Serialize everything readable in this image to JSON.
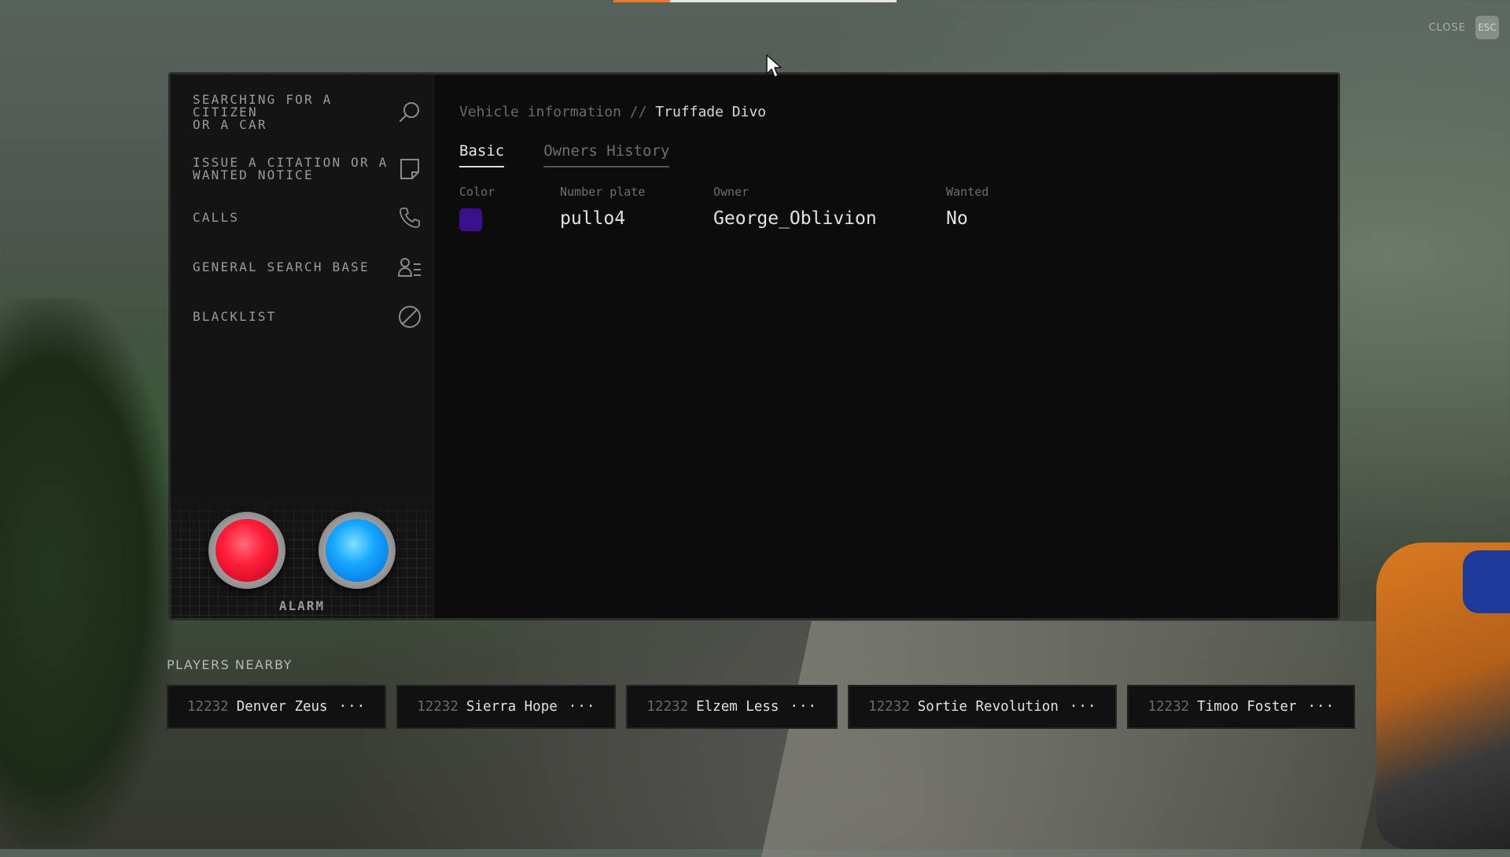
{
  "top_bar": {
    "progress": 0.2,
    "accent_color": "#e87a2a"
  },
  "close": {
    "label": "CLOSE",
    "key": "ESC"
  },
  "sidebar": {
    "items": [
      {
        "label": "SEARCHING FOR A\nCITIZEN\nOR A CAR",
        "icon": "search-icon"
      },
      {
        "label": "ISSUE A CITATION OR A\nWANTED NOTICE",
        "icon": "note-icon"
      },
      {
        "label": "CALLS",
        "icon": "phone-icon"
      },
      {
        "label": "GENERAL SEARCH BASE",
        "icon": "user-list-icon"
      },
      {
        "label": "BLACKLIST",
        "icon": "ban-icon"
      }
    ],
    "alarm": {
      "label": "ALARM",
      "red_color": "#ff1f3a",
      "blue_color": "#17a7ff"
    }
  },
  "main": {
    "breadcrumb": {
      "section": "Vehicle information //",
      "current": "Truffade Divo"
    },
    "tabs": [
      {
        "label": "Basic",
        "active": true
      },
      {
        "label": "Owners History",
        "active": false
      }
    ],
    "fields": {
      "color": {
        "label": "Color",
        "value": "#3a0f8a"
      },
      "plate": {
        "label": "Number plate",
        "value": "pullo4"
      },
      "owner": {
        "label": "Owner",
        "value": "George_Oblivion"
      },
      "wanted": {
        "label": "Wanted",
        "value": "No"
      }
    }
  },
  "players_nearby": {
    "title": "PLAYERS NEARBY",
    "players": [
      {
        "id": "12232",
        "name": "Denver Zeus",
        "more": "···"
      },
      {
        "id": "12232",
        "name": "Sierra Hope",
        "more": "···"
      },
      {
        "id": "12232",
        "name": "Elzem Less",
        "more": "···"
      },
      {
        "id": "12232",
        "name": "Sortie Revolution",
        "more": "···"
      },
      {
        "id": "12232",
        "name": "Timoo Foster",
        "more": "···"
      }
    ]
  }
}
